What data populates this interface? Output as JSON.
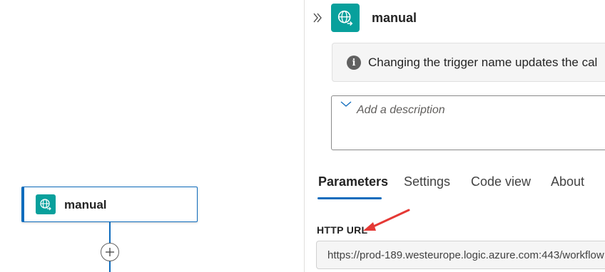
{
  "canvas": {
    "node": {
      "title": "manual",
      "icon": "globe-request-icon"
    },
    "add_button_icon": "plus-icon"
  },
  "panel": {
    "collapse_icon": "double-chevron-right-icon",
    "title": "manual",
    "icon": "globe-request-icon",
    "info_message": "Changing the trigger name updates the cal",
    "description_placeholder": "Add a description",
    "tabs": [
      {
        "label": "Parameters",
        "active": true
      },
      {
        "label": "Settings",
        "active": false
      },
      {
        "label": "Code view",
        "active": false
      },
      {
        "label": "About",
        "active": false
      }
    ],
    "http_url": {
      "label": "HTTP URL",
      "value": "https://prod-189.westeurope.logic.azure.com:443/workflow"
    }
  },
  "colors": {
    "accent": "#0f6cbd",
    "trigger_icon_bg": "#08a09c",
    "annotation_arrow": "#e53935"
  }
}
